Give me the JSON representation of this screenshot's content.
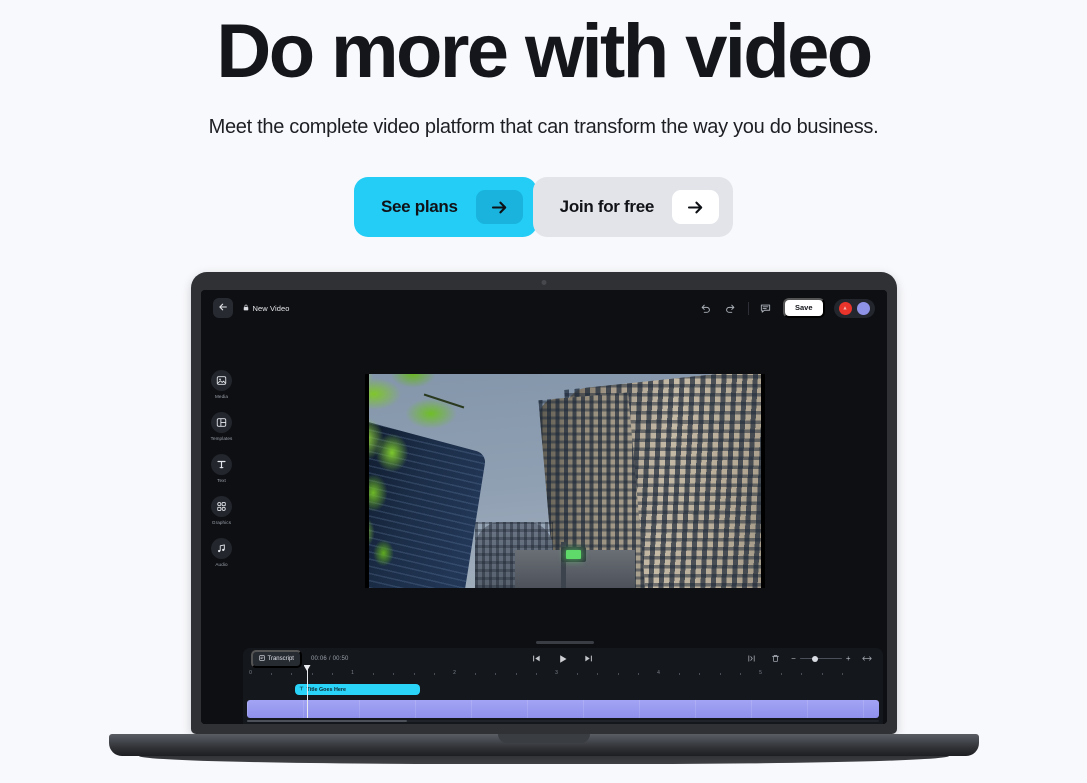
{
  "hero": {
    "title": "Do more with video",
    "subtitle": "Meet the complete video platform that can transform the way you do business.",
    "primary_cta": "See plans",
    "secondary_cta": "Join for free",
    "primary_color": "#24cdf5",
    "primary_chip_color": "#19b3dd",
    "secondary_color": "#e2e4e9",
    "page_background": "#f8f9fc"
  },
  "app": {
    "topbar": {
      "back_icon": "back-arrow-icon",
      "lock_icon": "lock-icon",
      "document_title": "New Video",
      "undo_icon": "undo-icon",
      "redo_icon": "redo-icon",
      "comment_icon": "comment-icon",
      "save_label": "Save",
      "avatars": [
        {
          "name": "avatar-red",
          "color": "#e8342a"
        },
        {
          "name": "avatar-blue",
          "color": "#8f93e8"
        }
      ]
    },
    "sidebar": {
      "items": [
        {
          "label": "Media",
          "icon": "image-icon"
        },
        {
          "label": "Templates",
          "icon": "layout-icon"
        },
        {
          "label": "Text",
          "icon": "text-t-icon"
        },
        {
          "label": "Graphics",
          "icon": "shapes-icon"
        },
        {
          "label": "Audio",
          "icon": "music-note-icon"
        }
      ]
    },
    "preview": {
      "alt": "Upward view of city skyscrapers with green foliage",
      "sky_color": "#8d9db0",
      "tower_right_color": "#c5baa6",
      "tower_left_color": "#1b2d47",
      "foliage_color": "#7fc62b"
    },
    "timeline": {
      "transcript_label": "Transcript",
      "transcript_icon": "transcript-icon",
      "time_current": "00:06",
      "time_total": "00:50",
      "time_display": "00:06 / 00:50",
      "skip_back_icon": "skip-back-icon",
      "play_icon": "play-icon",
      "skip_forward_icon": "skip-forward-icon",
      "split_icon": "split-icon",
      "delete_icon": "trash-icon",
      "zoom_out_label": "−",
      "zoom_in_label": "+",
      "fit_icon": "fit-width-icon",
      "zoom_value": 28,
      "ruler_labels": [
        "0",
        "1",
        "2",
        "3",
        "4",
        "5"
      ],
      "text_clip": {
        "label": "Title Goes Here",
        "icon": "text-t-icon",
        "color": "#2ad3f8"
      },
      "video_track": {
        "name": "video-track",
        "color": "#9a9bf0",
        "segments": 11
      },
      "playhead_position": "00:06"
    }
  }
}
